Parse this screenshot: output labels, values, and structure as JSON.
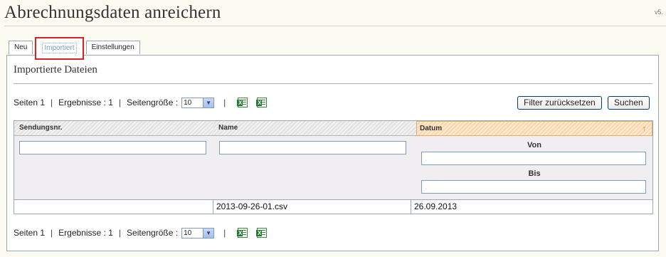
{
  "page": {
    "title": "Abrechnungsdaten anreichern",
    "version": "v5."
  },
  "tabs": [
    {
      "label": "Neu"
    },
    {
      "label": "Importiert"
    },
    {
      "label": "Einstellungen"
    }
  ],
  "panel": {
    "heading": "Importierte Dateien"
  },
  "pager": {
    "pages_label": "Seiten 1",
    "results_label": "Ergebnisse : 1",
    "pagesize_label": "Seitengröße :",
    "pagesize_value": "10",
    "separator": "|"
  },
  "buttons": {
    "reset_filter": "Filter zurücksetzen",
    "search": "Suchen"
  },
  "table": {
    "columns": [
      "Sendungsnr.",
      "Name",
      "Datum"
    ],
    "sorted_column": "Datum",
    "sort_direction": "ascending",
    "filter": {
      "from_label": "Von",
      "to_label": "Bis"
    },
    "rows": [
      {
        "sendungsnr": "",
        "name": "2013-09-26-01.csv",
        "datum": "26.09.2013"
      }
    ]
  },
  "icons": {
    "export_1": "excel-export-icon",
    "export_2": "excel-icon"
  },
  "colors": {
    "accent": "#e02020",
    "active_tab_text": "#6fa0c8",
    "sorted_header": "#fde9cf"
  }
}
